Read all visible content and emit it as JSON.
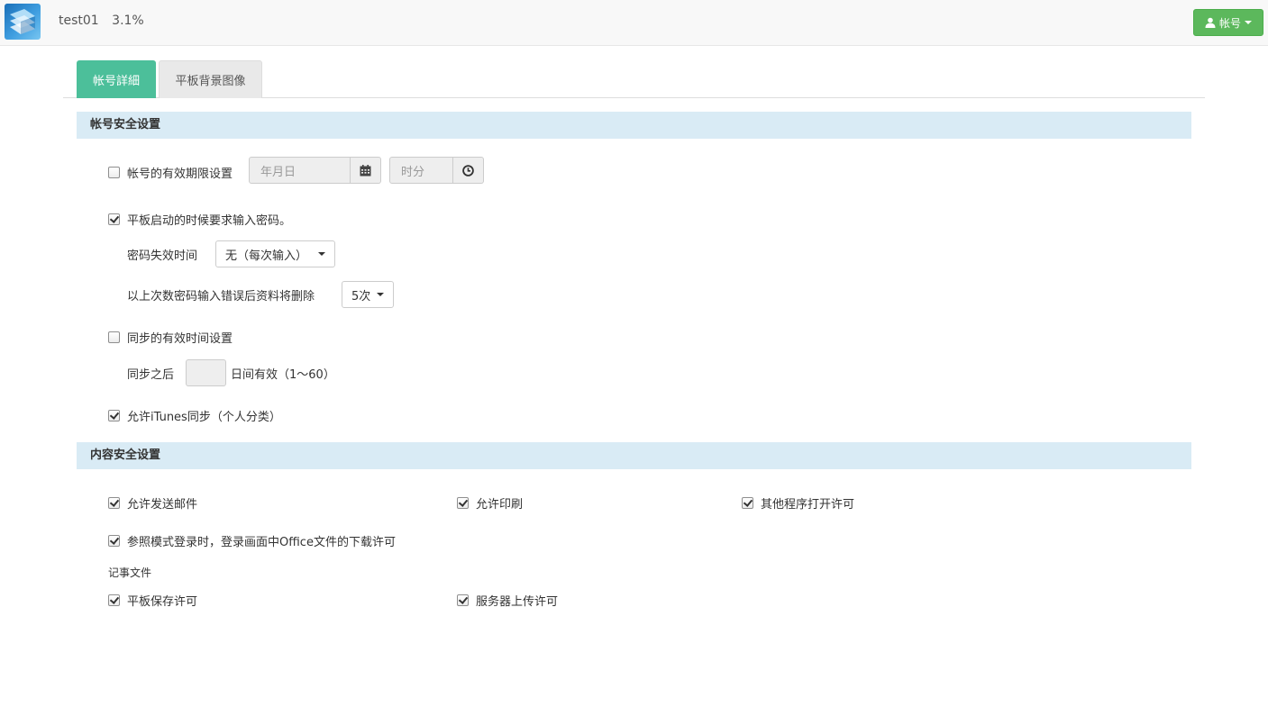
{
  "header": {
    "username": "test01",
    "usage": "3.1%",
    "account_label": "帐号"
  },
  "tabs": [
    {
      "label": "帐号詳細",
      "active": true
    },
    {
      "label": "平板背景图像",
      "active": false
    }
  ],
  "account_security": {
    "title": "帐号安全设置",
    "expiry": {
      "label": "帐号的有效期限设置",
      "checked": false,
      "date_placeholder": "年月日",
      "time_placeholder": "时分"
    },
    "require_password": {
      "label": "平板启动的时候要求输入密码。",
      "checked": true
    },
    "password_timeout": {
      "label": "密码失效时间",
      "selected": "无（每次输入）"
    },
    "wipe_after": {
      "label": "以上次数密码输入错误后资料将删除",
      "selected": "5次"
    },
    "sync_validity": {
      "label": "同步的有效时间设置",
      "checked": false
    },
    "sync_days": {
      "prefix": "同步之后",
      "suffix": "日间有效（1～60）",
      "value": ""
    },
    "itunes_sync": {
      "label": "允许iTunes同步（个人分类）",
      "checked": true
    }
  },
  "content_security": {
    "title": "内容安全设置",
    "allow_email": {
      "label": "允许发送邮件",
      "checked": true
    },
    "allow_print": {
      "label": "允许印刷",
      "checked": true
    },
    "allow_open_in": {
      "label": "其他程序打开许可",
      "checked": true
    },
    "office_download": {
      "label": "参照模式登录时，登录画面中Office文件的下载许可",
      "checked": true
    },
    "notes_heading": "记事文件",
    "tablet_save": {
      "label": "平板保存许可",
      "checked": true
    },
    "server_upload": {
      "label": "服务器上传许可",
      "checked": true
    }
  },
  "colors": {
    "accent_tab": "#4cbf9a",
    "account_button": "#5cb85c",
    "section_header_bg": "#d9ebf5"
  },
  "icons": {
    "logo": "app-logo",
    "account": "user-icon",
    "date": "calendar-icon",
    "time": "clock-icon"
  }
}
